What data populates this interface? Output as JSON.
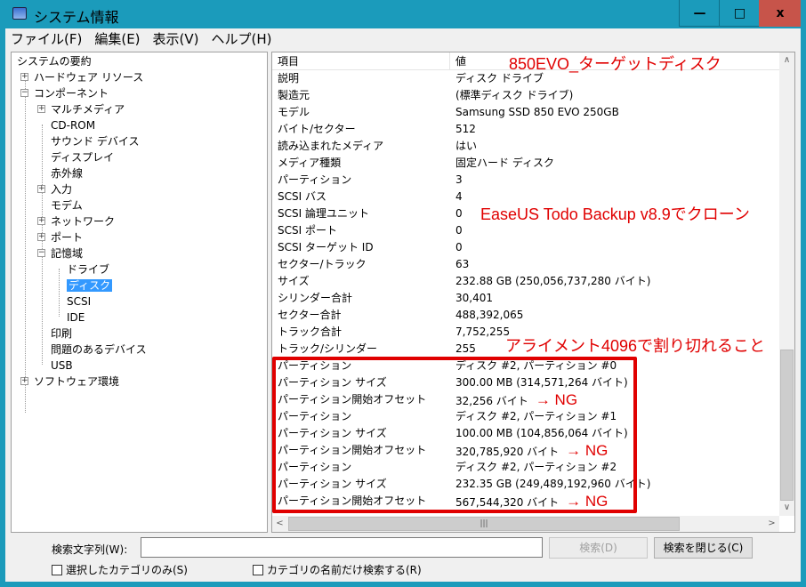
{
  "window": {
    "title": "システム情報",
    "minimize": "—",
    "maximize": "□",
    "close": "x"
  },
  "menu": [
    "ファイル(F)",
    "編集(E)",
    "表示(V)",
    "ヘルプ(H)"
  ],
  "tree": [
    {
      "label": "システムの要約",
      "level": 0,
      "exp": ""
    },
    {
      "label": "ハードウェア リソース",
      "level": 1,
      "exp": "+"
    },
    {
      "label": "コンポーネント",
      "level": 1,
      "exp": "-"
    },
    {
      "label": "マルチメディア",
      "level": 2,
      "exp": "+"
    },
    {
      "label": "CD-ROM",
      "level": 2,
      "exp": ""
    },
    {
      "label": "サウンド デバイス",
      "level": 2,
      "exp": ""
    },
    {
      "label": "ディスプレイ",
      "level": 2,
      "exp": ""
    },
    {
      "label": "赤外線",
      "level": 2,
      "exp": ""
    },
    {
      "label": "入力",
      "level": 2,
      "exp": "+"
    },
    {
      "label": "モデム",
      "level": 2,
      "exp": ""
    },
    {
      "label": "ネットワーク",
      "level": 2,
      "exp": "+"
    },
    {
      "label": "ポート",
      "level": 2,
      "exp": "+"
    },
    {
      "label": "記憶域",
      "level": 2,
      "exp": "-"
    },
    {
      "label": "ドライブ",
      "level": 3,
      "exp": ""
    },
    {
      "label": "ディスク",
      "level": 3,
      "exp": "",
      "selected": true
    },
    {
      "label": "SCSI",
      "level": 3,
      "exp": ""
    },
    {
      "label": "IDE",
      "level": 3,
      "exp": ""
    },
    {
      "label": "印刷",
      "level": 2,
      "exp": ""
    },
    {
      "label": "問題のあるデバイス",
      "level": 2,
      "exp": ""
    },
    {
      "label": "USB",
      "level": 2,
      "exp": ""
    },
    {
      "label": "ソフトウェア環境",
      "level": 1,
      "exp": "+"
    }
  ],
  "table": {
    "headers": [
      "項目",
      "値"
    ],
    "rows": [
      {
        "item": "説明",
        "value": "ディスク ドライブ"
      },
      {
        "item": "製造元",
        "value": "(標準ディスク ドライブ)"
      },
      {
        "item": "モデル",
        "value": "Samsung SSD 850 EVO 250GB"
      },
      {
        "item": "バイト/セクター",
        "value": "512"
      },
      {
        "item": "読み込まれたメディア",
        "value": "はい"
      },
      {
        "item": "メディア種類",
        "value": "固定ハード ディスク"
      },
      {
        "item": "パーティション",
        "value": "3"
      },
      {
        "item": "SCSI バス",
        "value": "4"
      },
      {
        "item": "SCSI 論理ユニット",
        "value": "0"
      },
      {
        "item": "SCSI ポート",
        "value": "0"
      },
      {
        "item": "SCSI ターゲット ID",
        "value": "0"
      },
      {
        "item": "セクター/トラック",
        "value": "63"
      },
      {
        "item": "サイズ",
        "value": "232.88 GB (250,056,737,280 バイト)"
      },
      {
        "item": "シリンダー合計",
        "value": "30,401"
      },
      {
        "item": "セクター合計",
        "value": "488,392,065"
      },
      {
        "item": "トラック合計",
        "value": "7,752,255"
      },
      {
        "item": "トラック/シリンダー",
        "value": "255"
      },
      {
        "item": "パーティション",
        "value": "ディスク #2, パーティション #0"
      },
      {
        "item": "パーティション サイズ",
        "value": "300.00 MB (314,571,264 バイト)"
      },
      {
        "item": "パーティション開始オフセット",
        "value": "32,256 バイト",
        "note": "→ NG"
      },
      {
        "item": "パーティション",
        "value": "ディスク #2, パーティション #1"
      },
      {
        "item": "パーティション サイズ",
        "value": "100.00 MB (104,856,064 バイト)"
      },
      {
        "item": "パーティション開始オフセット",
        "value": "320,785,920 バイト",
        "note": "→ NG"
      },
      {
        "item": "パーティション",
        "value": "ディスク #2, パーティション #2"
      },
      {
        "item": "パーティション サイズ",
        "value": "232.35 GB (249,489,192,960 バイト)"
      },
      {
        "item": "パーティション開始オフセット",
        "value": "567,544,320 バイト",
        "note": "→ NG"
      }
    ]
  },
  "scroll": {
    "vertical_position": 1.0
  },
  "annotations": {
    "title": "850EVO_ターゲットディスク",
    "clone": "EaseUS Todo Backup v8.9でクローン",
    "alignment": "アライメント4096で割り切れること",
    "color": "#e00000"
  },
  "search": {
    "label": "検索文字列(W):",
    "value": "",
    "find": "検索(D)",
    "close": "検索を閉じる(C)",
    "only_selected": "選択したカテゴリのみ(S)",
    "names_only": "カテゴリの名前だけ検索する(R)"
  }
}
